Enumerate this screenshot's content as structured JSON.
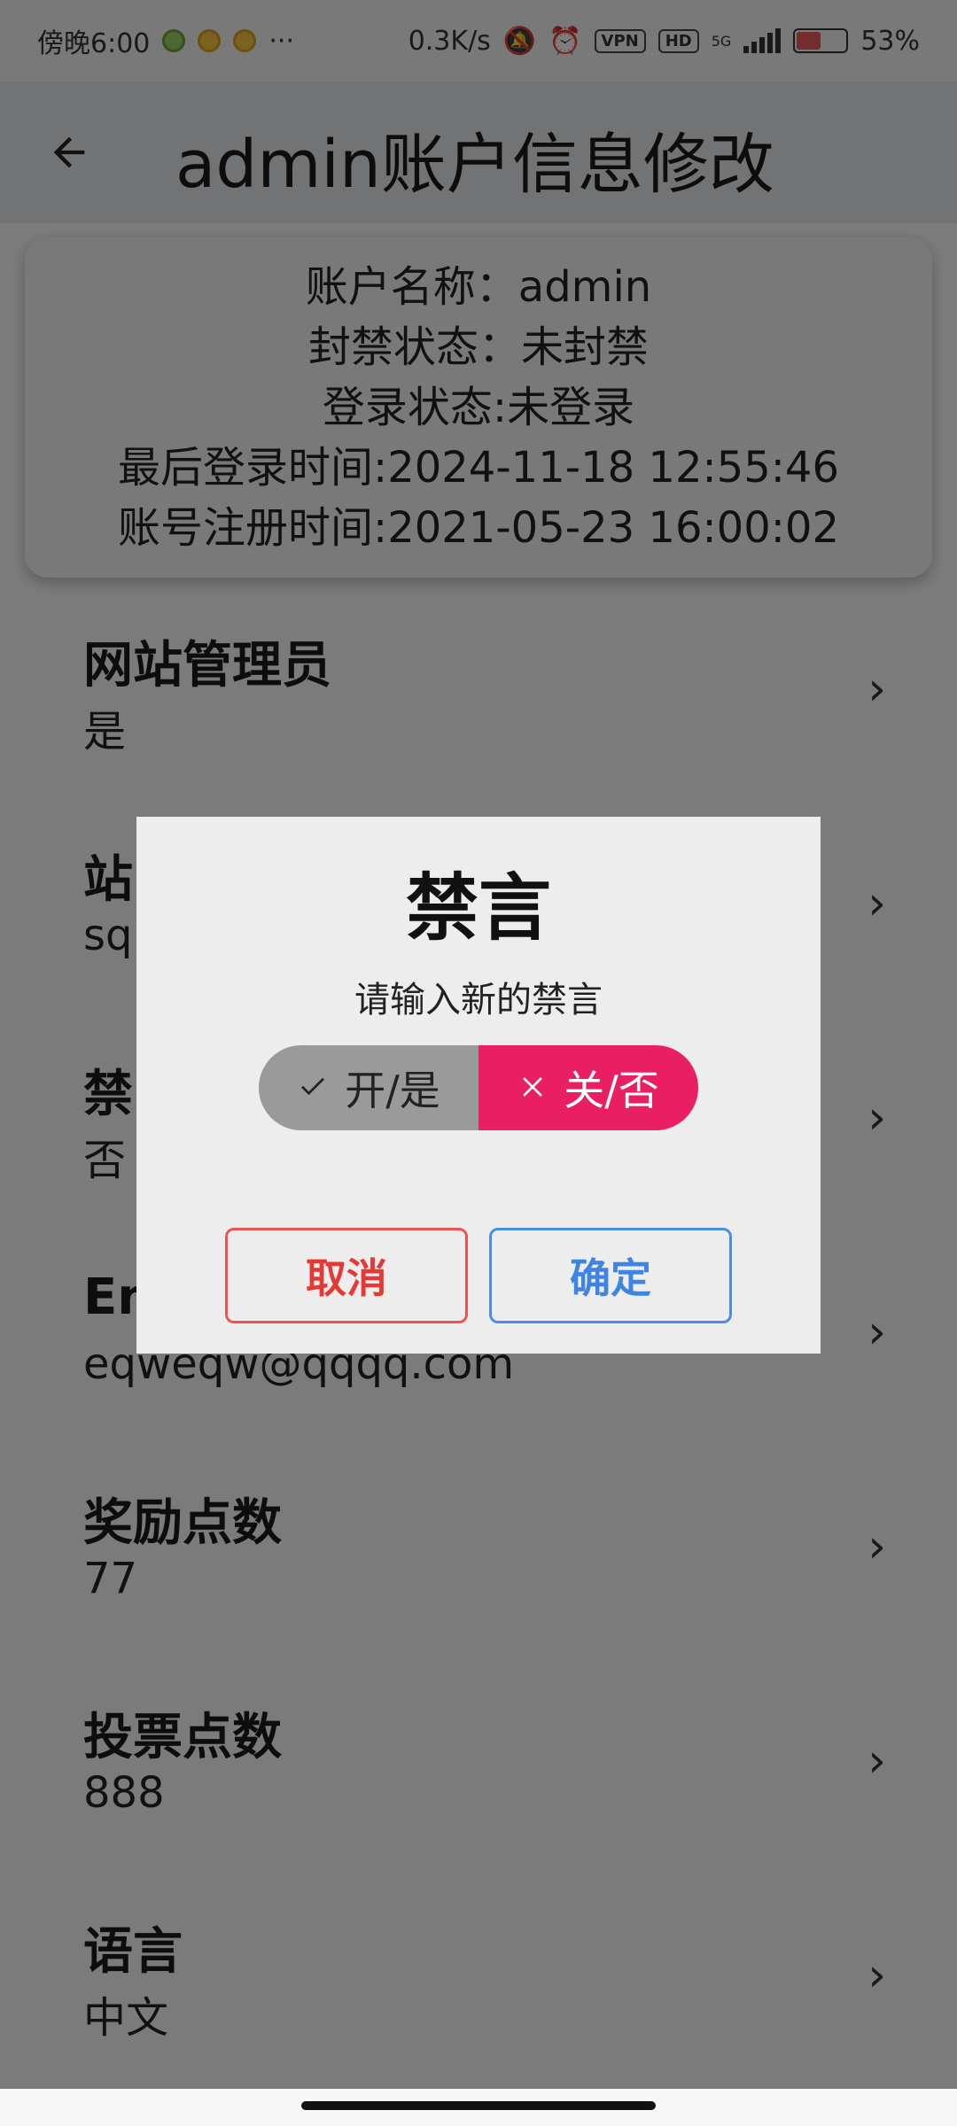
{
  "status_bar": {
    "time": "傍晚6:00",
    "dots": "···",
    "speed": "0.3K/s",
    "vpn": "VPN",
    "hd": "HD",
    "network": "5G",
    "battery_percent": "53%",
    "battery_level": 0.53
  },
  "app_bar": {
    "title": "admin账户信息修改"
  },
  "info_card": {
    "lines": [
      "账户名称：admin",
      "封禁状态：未封禁",
      "登录状态:未登录",
      "最后登录时间:2024-11-18 12:55:46",
      "账号注册时间:2021-05-23 16:00:02"
    ]
  },
  "list": [
    {
      "title": "网站管理员",
      "value": "是"
    },
    {
      "title": "站",
      "value": "sq"
    },
    {
      "title": "禁",
      "value": "否"
    },
    {
      "title": "En",
      "value": "eqweqw@qqqq.com"
    },
    {
      "title": "奖励点数",
      "value": "77"
    },
    {
      "title": "投票点数",
      "value": "888"
    },
    {
      "title": "语言",
      "value": "中文"
    }
  ],
  "dialog": {
    "title": "禁言",
    "message": "请输入新的禁言",
    "toggle_yes": "开/是",
    "toggle_no": "关/否",
    "selected": "关/否",
    "cancel": "取消",
    "confirm": "确定"
  },
  "colors": {
    "accent": "#e91e63",
    "cancel": "#e53935",
    "confirm": "#3d85e0"
  }
}
